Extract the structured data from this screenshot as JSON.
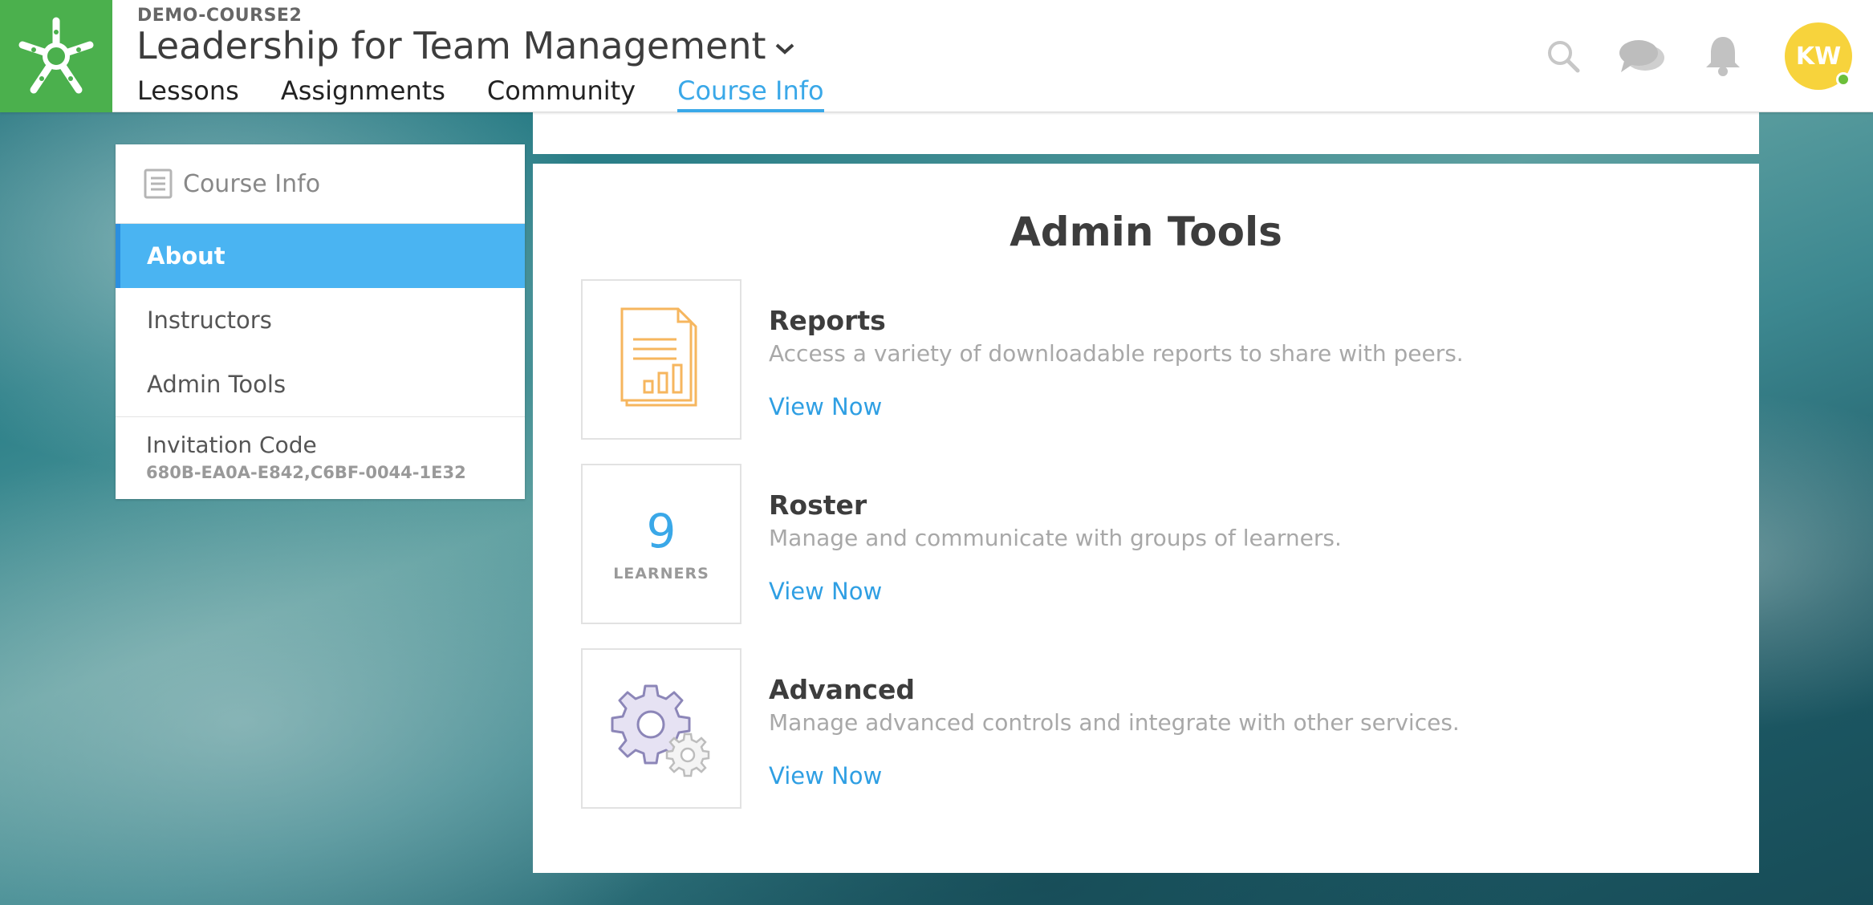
{
  "header": {
    "course_code": "DEMO-COURSE2",
    "course_title": "Leadership for Team Management",
    "nav": [
      "Lessons",
      "Assignments",
      "Community",
      "Course Info"
    ],
    "active_nav": "Course Info",
    "avatar_initials": "KW",
    "icons": [
      "search-icon",
      "chat-icon",
      "bell-icon"
    ]
  },
  "sidebar": {
    "title": "Course Info",
    "items": [
      "About",
      "Instructors",
      "Admin Tools"
    ],
    "active_item": "About",
    "invitation_label": "Invitation Code",
    "invitation_code": "680B-EA0A-E842,C6BF-0044-1E32"
  },
  "main": {
    "title": "Admin Tools",
    "tools": [
      {
        "name": "Reports",
        "description": "Access a variety of downloadable reports to share with peers.",
        "link": "View Now",
        "icon": "report-icon"
      },
      {
        "name": "Roster",
        "description": "Manage and communicate with groups of learners.",
        "link": "View Now",
        "count": "9",
        "count_label": "LEARNERS"
      },
      {
        "name": "Advanced",
        "description": "Manage advanced controls and integrate with other services.",
        "link": "View Now",
        "icon": "gear-icon"
      }
    ]
  },
  "colors": {
    "brand_green": "#4bb04d",
    "accent_blue": "#3aa8e8",
    "active_sidebar": "#4ab4f2",
    "avatar_yellow": "#f7d33c"
  }
}
